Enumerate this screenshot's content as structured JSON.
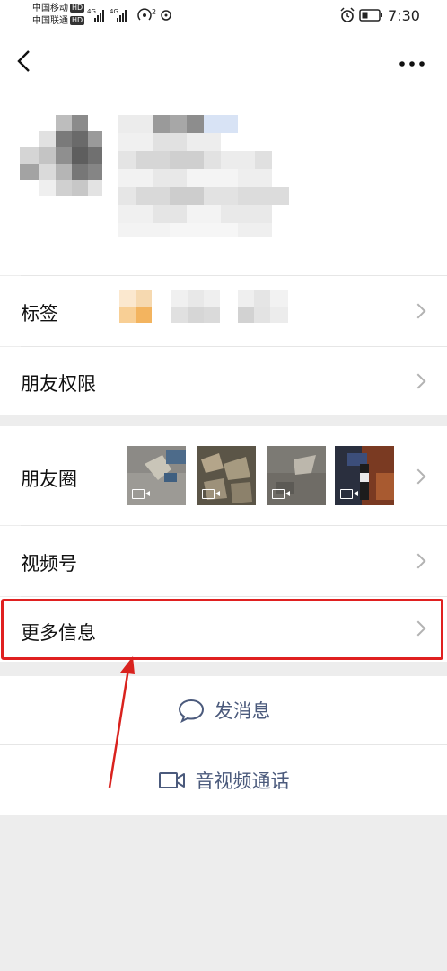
{
  "status_bar": {
    "carrier1": "中国移动",
    "carrier2": "中国联通",
    "hd_badge": "HD",
    "network1": "4G",
    "network2": "4G",
    "hotspot_count": "2",
    "time": "7:30"
  },
  "nav": {
    "back_icon": "chevron-left",
    "more_icon": "ellipsis"
  },
  "rows": {
    "tags_label": "标签",
    "permissions_label": "朋友权限",
    "moments_label": "朋友圈",
    "channels_label": "视频号",
    "more_info_label": "更多信息"
  },
  "actions": {
    "message_label": "发消息",
    "call_label": "音视频通话"
  },
  "colors": {
    "highlight_border": "#e02020",
    "action_text": "#4b5a7c",
    "arrow": "#d9221e"
  }
}
